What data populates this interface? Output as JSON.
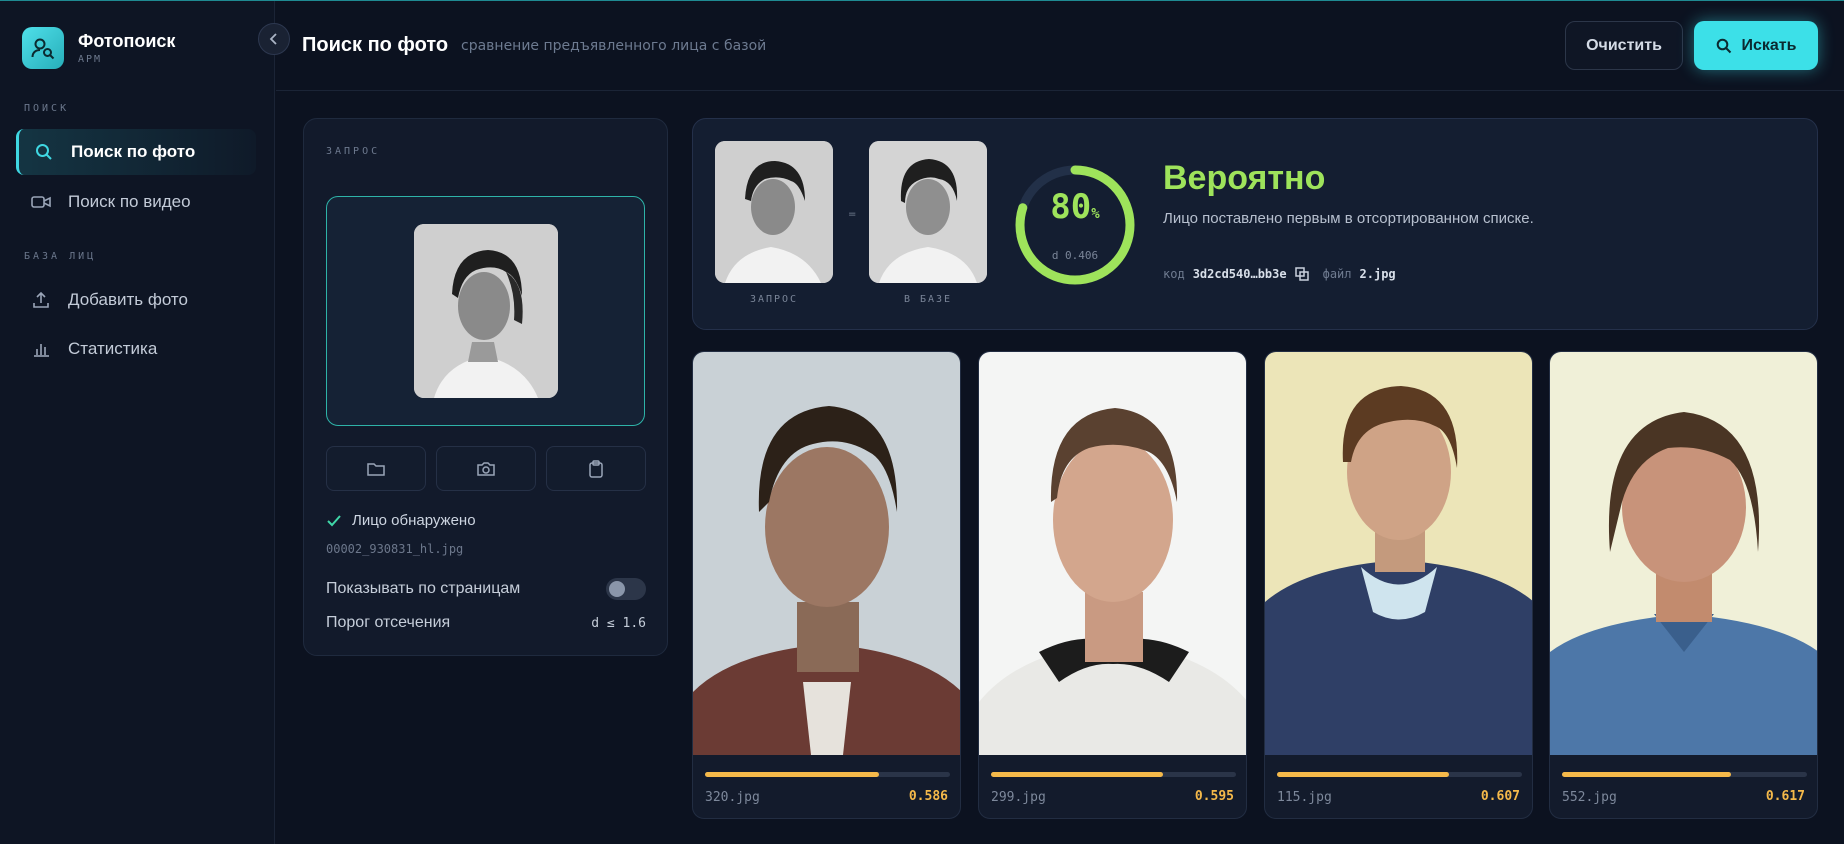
{
  "brand": {
    "name": "Фотопоиск",
    "sub": "АРМ"
  },
  "sidebar": {
    "section_search": "ПОИСК",
    "section_db": "БАЗА ЛИЦ",
    "items": [
      {
        "label": "Поиск по фото",
        "icon": "search-icon",
        "active": true
      },
      {
        "label": "Поиск по видео",
        "icon": "video-icon",
        "active": false
      },
      {
        "label": "Добавить фото",
        "icon": "upload-icon",
        "active": false
      },
      {
        "label": "Статистика",
        "icon": "bar-chart-icon",
        "active": false
      }
    ]
  },
  "header": {
    "title": "Поиск по фото",
    "subtitle": "сравнение предъявленного лица с базой",
    "clear_label": "Очистить",
    "search_label": "Искать"
  },
  "query": {
    "label": "ЗАПРОС",
    "status": "Лицо обнаружено",
    "filename": "00002_930831_hl.jpg",
    "paginate_label": "Показывать по страницам",
    "paginate_on": false,
    "threshold_label": "Порог отсечения",
    "threshold_value": "d ≤ 1.6"
  },
  "result": {
    "query_label": "ЗАПРОС",
    "db_label": "В БАЗЕ",
    "eq": "=",
    "percent": "80",
    "percent_unit": "%",
    "percent_fraction": 0.8,
    "distance": "d 0.406",
    "verdict": "Вероятно",
    "description": "Лицо поставлено первым в отсортированном списке.",
    "code_key": "код",
    "code_value": "3d2cd540…bb3e",
    "file_key": "файл",
    "file_value": "2.jpg"
  },
  "candidates": [
    {
      "file": "320.jpg",
      "score": "0.586",
      "fill": 0.71
    },
    {
      "file": "299.jpg",
      "score": "0.595",
      "fill": 0.7
    },
    {
      "file": "115.jpg",
      "score": "0.607",
      "fill": 0.7
    },
    {
      "file": "552.jpg",
      "score": "0.617",
      "fill": 0.69
    }
  ],
  "colors": {
    "accent": "#3ce0e8",
    "match": "#9ee35b",
    "score": "#f5b94a",
    "background": "#0c1220"
  }
}
